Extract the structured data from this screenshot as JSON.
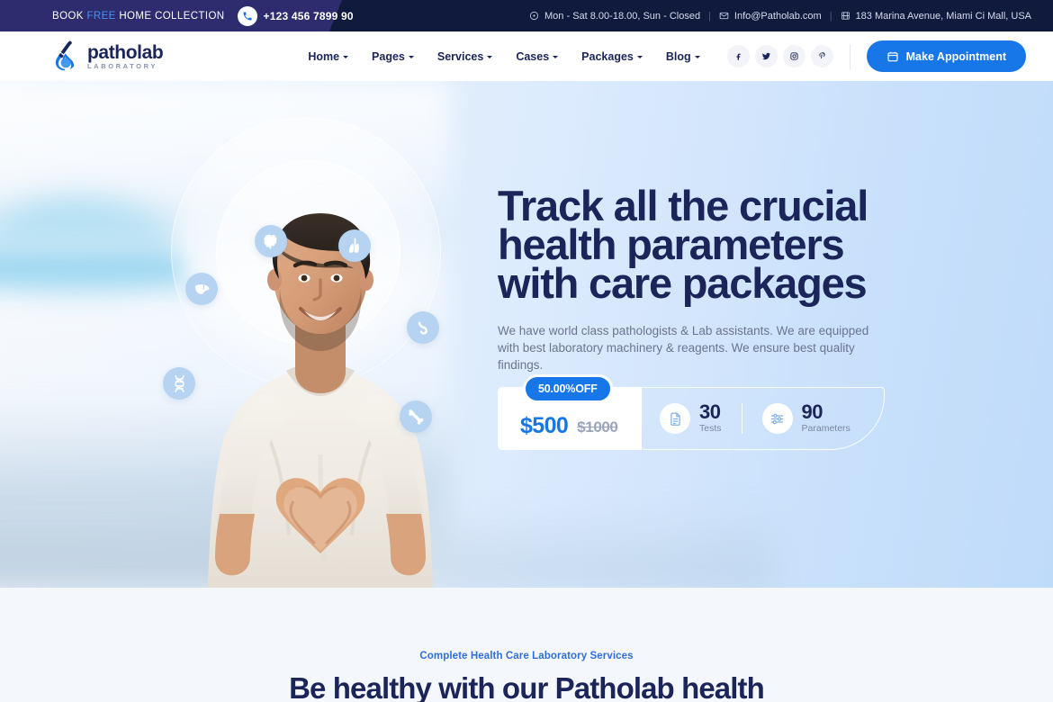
{
  "topbar": {
    "book_prefix": "BOOK ",
    "book_free": "FREE",
    "book_suffix": " HOME COLLECTION",
    "phone": "+123 456 7899 90",
    "hours": "Mon - Sat 8.00-18.00, Sun - Closed",
    "email": "Info@Patholab.com",
    "address": "183 Marina Avenue, Miami Ci Mall, USA",
    "separator": "|",
    "icons": {
      "phone": "phone-icon",
      "clock": "clock-icon",
      "mail": "mail-icon",
      "building": "building-icon"
    }
  },
  "header": {
    "logo_name": "patholab",
    "logo_sub": "LABORATORY",
    "logo_icon": "flask-drop-icon",
    "nav": [
      {
        "label": "Home",
        "has_dropdown": true
      },
      {
        "label": "Pages",
        "has_dropdown": true
      },
      {
        "label": "Services",
        "has_dropdown": true
      },
      {
        "label": "Cases",
        "has_dropdown": true
      },
      {
        "label": "Packages",
        "has_dropdown": true
      },
      {
        "label": "Blog",
        "has_dropdown": true
      }
    ],
    "socials": [
      {
        "name": "facebook-icon",
        "glyph": "f"
      },
      {
        "name": "twitter-icon",
        "glyph": "t"
      },
      {
        "name": "instagram-icon",
        "glyph": "i"
      },
      {
        "name": "pinterest-icon",
        "glyph": "p"
      }
    ],
    "appointment_button": "Make Appointment",
    "appointment_icon": "calendar-icon",
    "accent_color": "#1877e8"
  },
  "hero": {
    "title_line1": "Track all the crucial",
    "title_line2": "health parameters",
    "title_line3": "with care packages",
    "description": "We have world class pathologists & Lab assistants. We are equipped with best laboratory machinery & reagents. We ensure best quality findings.",
    "badge": "50.00%OFF",
    "price_now": "$500",
    "price_old": "$1000",
    "stats": [
      {
        "value": "30",
        "label": "Tests",
        "icon": "report-document-icon"
      },
      {
        "value": "90",
        "label": "Parameters",
        "icon": "sliders-icon"
      }
    ],
    "orbit_icons": [
      "brain-icon",
      "lungs-icon",
      "liver-icon",
      "stomach-icon",
      "dna-icon",
      "bone-icon"
    ],
    "title_color": "#1b2559",
    "gradient_from": "#eef4fb",
    "gradient_to": "#bfdbfa"
  },
  "section": {
    "eyebrow": "Complete Health Care Laboratory Services",
    "title": "Be healthy with our Patholab health",
    "eyebrow_color": "#2f6fdb",
    "background": "#f4f7fb"
  }
}
